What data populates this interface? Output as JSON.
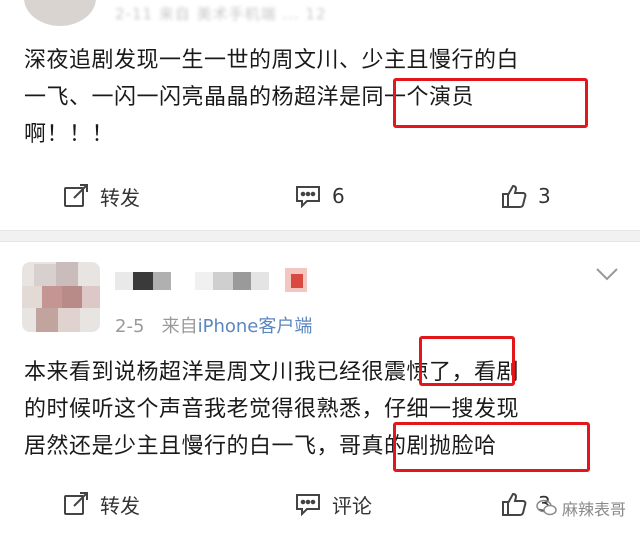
{
  "post1": {
    "meta_blurred": "2-11  来自 美术手机端 ...  12",
    "lines": [
      "深夜追剧发现一生一世的周文川、少主且慢行的白",
      "一飞、一闪一闪亮晶晶的杨超洋是同一个演员",
      "啊！！！"
    ],
    "share_label": "转发",
    "comment_count": "6",
    "like_count": "3"
  },
  "post2": {
    "date": "2-5",
    "source_prefix": "来自",
    "source": "iPhone客户端",
    "lines": [
      "本来看到说杨超洋是周文川我已经很震惊了，看剧",
      "的时候听这个声音我老觉得很熟悉，仔细一搜发现",
      "居然还是少主且慢行的白一飞，哥真的剧抛脸哈"
    ],
    "share_label": "转发",
    "comment_label": "评论",
    "like_count": "3"
  },
  "watermark": "麻辣表哥",
  "colors": {
    "highlight": "#e2161b",
    "link": "#5b86c0",
    "meta": "#9a9a9a"
  }
}
